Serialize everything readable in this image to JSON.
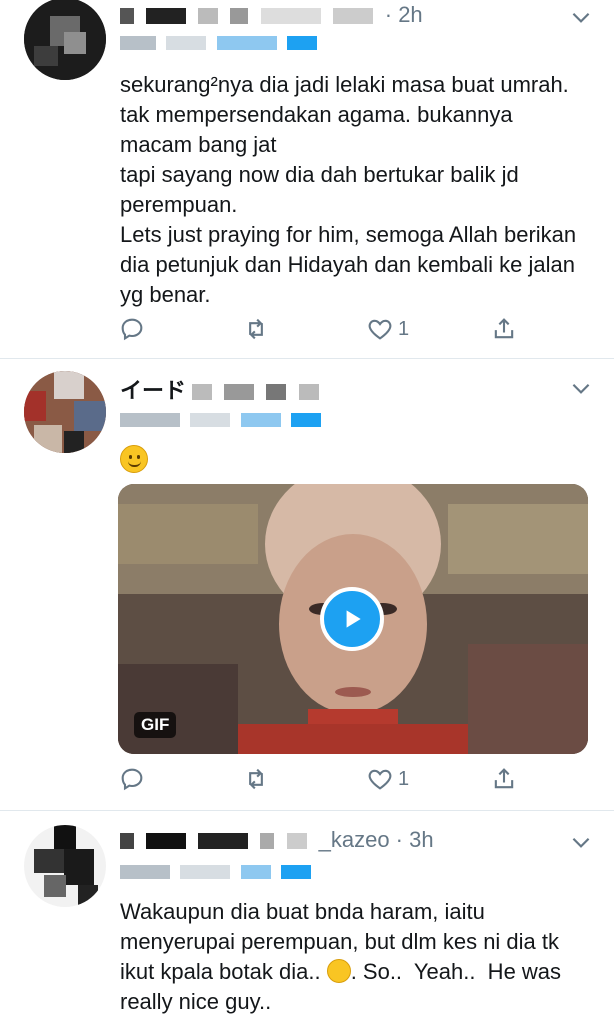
{
  "tweets": [
    {
      "time": "· 2h",
      "body": "sekurang²nya dia jadi lelaki masa buat umrah. tak mempersendakan agama. bukannya macam bang jat\ntapi sayang now dia dah bertukar balik jd perempuan.\nLets just praying for him, semoga Allah berikan dia petunjuk dan Hidayah dan kembali ke jalan yg benar.",
      "reply_count": "",
      "retweet_count": "",
      "like_count": "1"
    },
    {
      "name_fragment": "イード",
      "media_badge": "GIF",
      "reply_count": "",
      "retweet_count": "",
      "like_count": "1"
    },
    {
      "time_fragment": "_kazeo · 3h",
      "body": "Wakaupun dia buat bnda haram, iaitu menyerupai perempuan, but dlm kes ni dia tk ikut kpala botak dia.. ",
      "body_after_emoji": ". So..  Yeah..  He was really nice guy.."
    }
  ],
  "icons": {
    "reply": "reply-icon",
    "retweet": "retweet-icon",
    "like": "like-icon",
    "share": "share-icon",
    "more": "chevron-down-icon",
    "play": "play-icon",
    "emoji1": "slightly-smiling-face-emoji",
    "emoji2": "tears-of-joy-emoji"
  },
  "colors": {
    "text": "#14171a",
    "secondary": "#657786",
    "accent": "#1da1f2",
    "divider": "#e1e8ed"
  }
}
